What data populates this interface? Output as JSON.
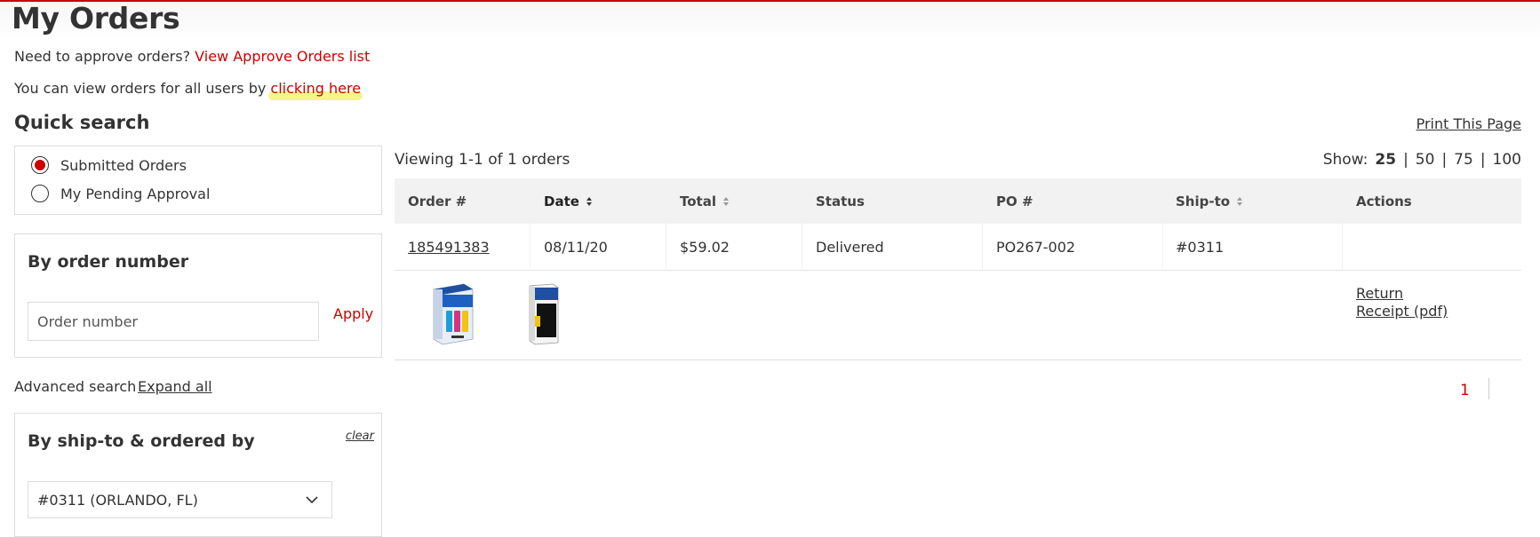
{
  "page": {
    "title": "My Orders",
    "approve_prompt": "Need to approve orders?",
    "approve_link": "View Approve Orders list",
    "all_users_prompt": "You can view orders for all users by",
    "all_users_link": "clicking here",
    "accent_color": "#cc0000"
  },
  "quick_search": {
    "title": "Quick search",
    "options": [
      {
        "label": "Submitted Orders",
        "selected": true
      },
      {
        "label": "My Pending Approval",
        "selected": false
      }
    ]
  },
  "by_order_number": {
    "heading": "By order number",
    "placeholder": "Order number",
    "apply_label": "Apply"
  },
  "advanced": {
    "label": "Advanced search",
    "expand_label": "Expand all"
  },
  "by_ship_to": {
    "heading": "By ship-to & ordered by",
    "clear_label": "clear",
    "selected_value": "#0311 (ORLANDO, FL)"
  },
  "results": {
    "print_label": "Print This Page",
    "viewing_text": "Viewing 1-1 of 1 orders",
    "show_label": "Show:",
    "page_sizes": [
      "25",
      "50",
      "75",
      "100"
    ],
    "active_page_size": "25"
  },
  "table": {
    "headers": {
      "order": "Order #",
      "date": "Date",
      "total": "Total",
      "status": "Status",
      "po": "PO #",
      "ship_to": "Ship-to",
      "actions": "Actions"
    },
    "rows": [
      {
        "order": "185491383",
        "date": "08/11/20",
        "total": "$59.02",
        "status": "Delivered",
        "po": "PO267-002",
        "ship_to": "#0311",
        "actions": [
          "Return",
          "Receipt (pdf)"
        ],
        "products": [
          "epson-ink-multipack",
          "epson-black-ink-bottle"
        ]
      }
    ]
  },
  "pagination": {
    "current_page": "1"
  }
}
